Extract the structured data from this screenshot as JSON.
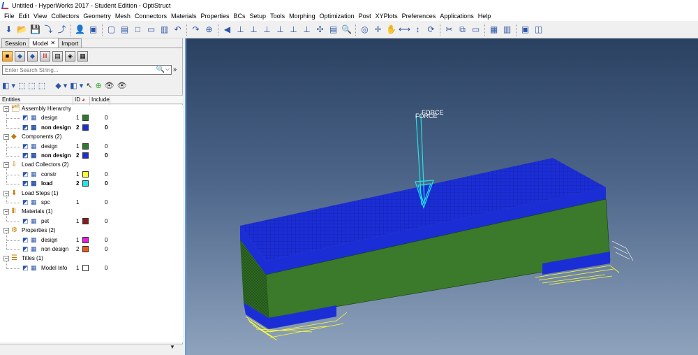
{
  "window": {
    "title": "Untitled - HyperWorks 2017 - Student Edition - OptiStruct"
  },
  "menu": [
    "File",
    "Edit",
    "View",
    "Collectors",
    "Geometry",
    "Mesh",
    "Connectors",
    "Materials",
    "Properties",
    "BCs",
    "Setup",
    "Tools",
    "Morphing",
    "Optimization",
    "Post",
    "XYPlots",
    "Preferences",
    "Applications",
    "Help"
  ],
  "toolbar_icons": [
    "import-icon",
    "open-icon",
    "save-icon",
    "import-geometry-icon",
    "export-icon",
    "user-icon",
    "component-icon",
    "new-icon",
    "open-file-icon",
    "box-select-icon",
    "window-icon",
    "page-icon",
    "undo-icon",
    "redo-icon",
    "zoom-icon",
    "rotate-left-icon",
    "view-front-icon",
    "view-back-icon",
    "view-left-icon",
    "view-right-icon",
    "view-top-icon",
    "view-bottom-icon",
    "view-iso-icon",
    "fit-icon",
    "magnify-icon",
    "circle-zoom-icon",
    "pan-icon",
    "hand-icon",
    "expand-h-icon",
    "expand-v-icon",
    "spin-icon",
    "cut-icon",
    "copy-icon",
    "paste-icon",
    "layout-icon",
    "grid-icon",
    "frame-icon",
    "window-split-icon"
  ],
  "tabs": [
    {
      "label": "Session",
      "active": false
    },
    {
      "label": "Model",
      "active": true
    },
    {
      "label": "Import",
      "active": false
    }
  ],
  "search": {
    "placeholder": "Enter Search String..."
  },
  "tree_columns": {
    "entities": "Entities",
    "id": "ID",
    "include": "Include"
  },
  "tree": [
    {
      "type": "group",
      "label": "Assembly Hierarchy",
      "icon": "assembly-icon"
    },
    {
      "type": "item",
      "label": "design",
      "id": "1",
      "color": "#2f7a2f",
      "include": "0",
      "bold": false
    },
    {
      "type": "item",
      "label": "non design",
      "id": "2",
      "color": "#1b2ed6",
      "include": "0",
      "bold": true
    },
    {
      "type": "group",
      "label": "Components (2)",
      "icon": "components-icon"
    },
    {
      "type": "item",
      "label": "design",
      "id": "1",
      "color": "#2f7a2f",
      "include": "0",
      "bold": false
    },
    {
      "type": "item",
      "label": "non design",
      "id": "2",
      "color": "#1b2ed6",
      "include": "0",
      "bold": true
    },
    {
      "type": "group",
      "label": "Load Collectors (2)",
      "icon": "load-collectors-icon"
    },
    {
      "type": "item",
      "label": "constr",
      "id": "1",
      "color": "#ffff33",
      "include": "0",
      "bold": false
    },
    {
      "type": "item",
      "label": "load",
      "id": "2",
      "color": "#22e3e8",
      "include": "0",
      "bold": true
    },
    {
      "type": "group",
      "label": "Load Steps (1)",
      "icon": "load-steps-icon"
    },
    {
      "type": "item",
      "label": "spc",
      "id": "1",
      "color": "",
      "include": "0",
      "bold": false
    },
    {
      "type": "group",
      "label": "Materials (1)",
      "icon": "materials-icon"
    },
    {
      "type": "item",
      "label": "pet",
      "id": "1",
      "color": "#8b1a1a",
      "include": "0",
      "bold": false
    },
    {
      "type": "group",
      "label": "Properties (2)",
      "icon": "properties-icon"
    },
    {
      "type": "item",
      "label": "design",
      "id": "1",
      "color": "#e81ce8",
      "include": "0",
      "bold": false
    },
    {
      "type": "item",
      "label": "non design",
      "id": "2",
      "color": "#e85a1c",
      "include": "0",
      "bold": false
    },
    {
      "type": "group",
      "label": "Titles (1)",
      "icon": "titles-icon"
    },
    {
      "type": "item",
      "label": "Model Info",
      "id": "1",
      "color": "#ffffff",
      "include": "0",
      "bold": false
    }
  ],
  "viewport": {
    "force_labels": [
      "FORCE",
      "FORCE"
    ],
    "colors": {
      "design": "#3a7a2a",
      "non_design": "#1b2ed6",
      "force": "#22e3e8",
      "constraint": "#ffff33"
    }
  }
}
